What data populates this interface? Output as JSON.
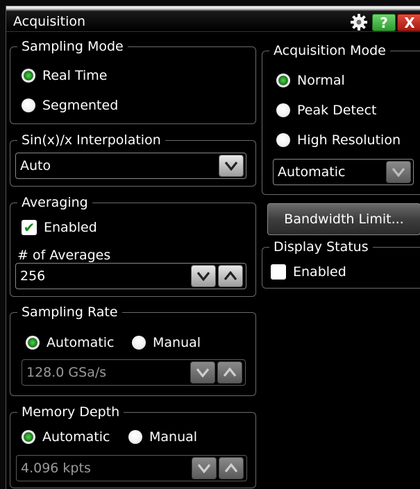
{
  "window": {
    "title": "Acquisition"
  },
  "toolbar": {
    "help_label": "?",
    "close_label": "X"
  },
  "sampling_mode": {
    "title": "Sampling Mode",
    "options": [
      {
        "label": "Real Time",
        "selected": true
      },
      {
        "label": "Segmented",
        "selected": false
      }
    ]
  },
  "interpolation": {
    "title": "Sin(x)/x Interpolation",
    "value": "Auto"
  },
  "averaging": {
    "title": "Averaging",
    "enabled_label": "Enabled",
    "enabled": true,
    "count_label": "# of Averages",
    "count_value": "256"
  },
  "sampling_rate": {
    "title": "Sampling Rate",
    "options": [
      {
        "label": "Automatic",
        "selected": true
      },
      {
        "label": "Manual",
        "selected": false
      }
    ],
    "value": "128.0 GSa/s"
  },
  "memory_depth": {
    "title": "Memory Depth",
    "options": [
      {
        "label": "Automatic",
        "selected": true
      },
      {
        "label": "Manual",
        "selected": false
      }
    ],
    "value": "4.096 kpts"
  },
  "acquisition_mode": {
    "title": "Acquisition Mode",
    "options": [
      {
        "label": "Normal",
        "selected": true
      },
      {
        "label": "Peak Detect",
        "selected": false
      },
      {
        "label": "High Resolution",
        "selected": false
      }
    ],
    "resolution_value": "Automatic"
  },
  "bandwidth_button": {
    "label": "Bandwidth Limit..."
  },
  "display_status": {
    "title": "Display Status",
    "enabled_label": "Enabled",
    "enabled": false
  },
  "colors": {
    "radio_selected": "#2a9a2a",
    "check_mark": "#1d8a1d",
    "help_button": "#3aaa3a",
    "close_button": "#c0281c"
  }
}
